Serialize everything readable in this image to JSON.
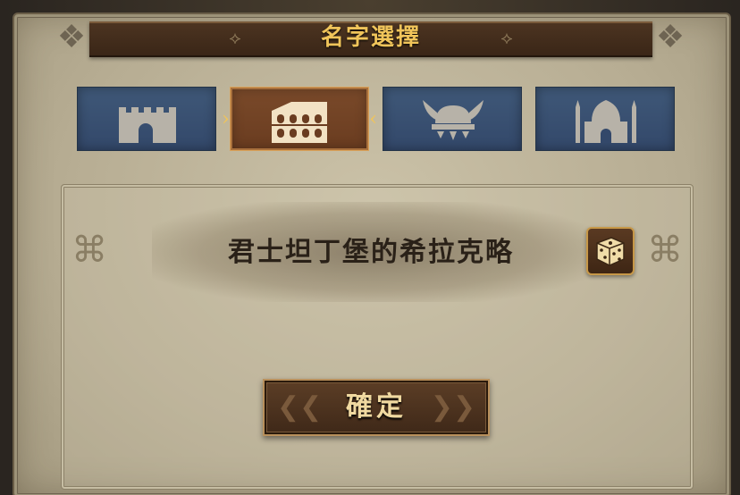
{
  "header": {
    "title": "名字選擇"
  },
  "culture_tabs": [
    {
      "icon": "castle-icon",
      "selected": false
    },
    {
      "icon": "colosseum-icon",
      "selected": true
    },
    {
      "icon": "viking-helmet-icon",
      "selected": false
    },
    {
      "icon": "mosque-icon",
      "selected": false
    }
  ],
  "name": {
    "value": "君士坦丁堡的希拉克略"
  },
  "dice": {
    "icon": "dice-icon"
  },
  "confirm": {
    "label": "確定"
  },
  "colors": {
    "title": "#f0c45a",
    "tab_normal": "#3f5878",
    "tab_selected": "#7a4a2a",
    "parchment": "#cbc2a8",
    "button_brown": "#5c3e26"
  }
}
